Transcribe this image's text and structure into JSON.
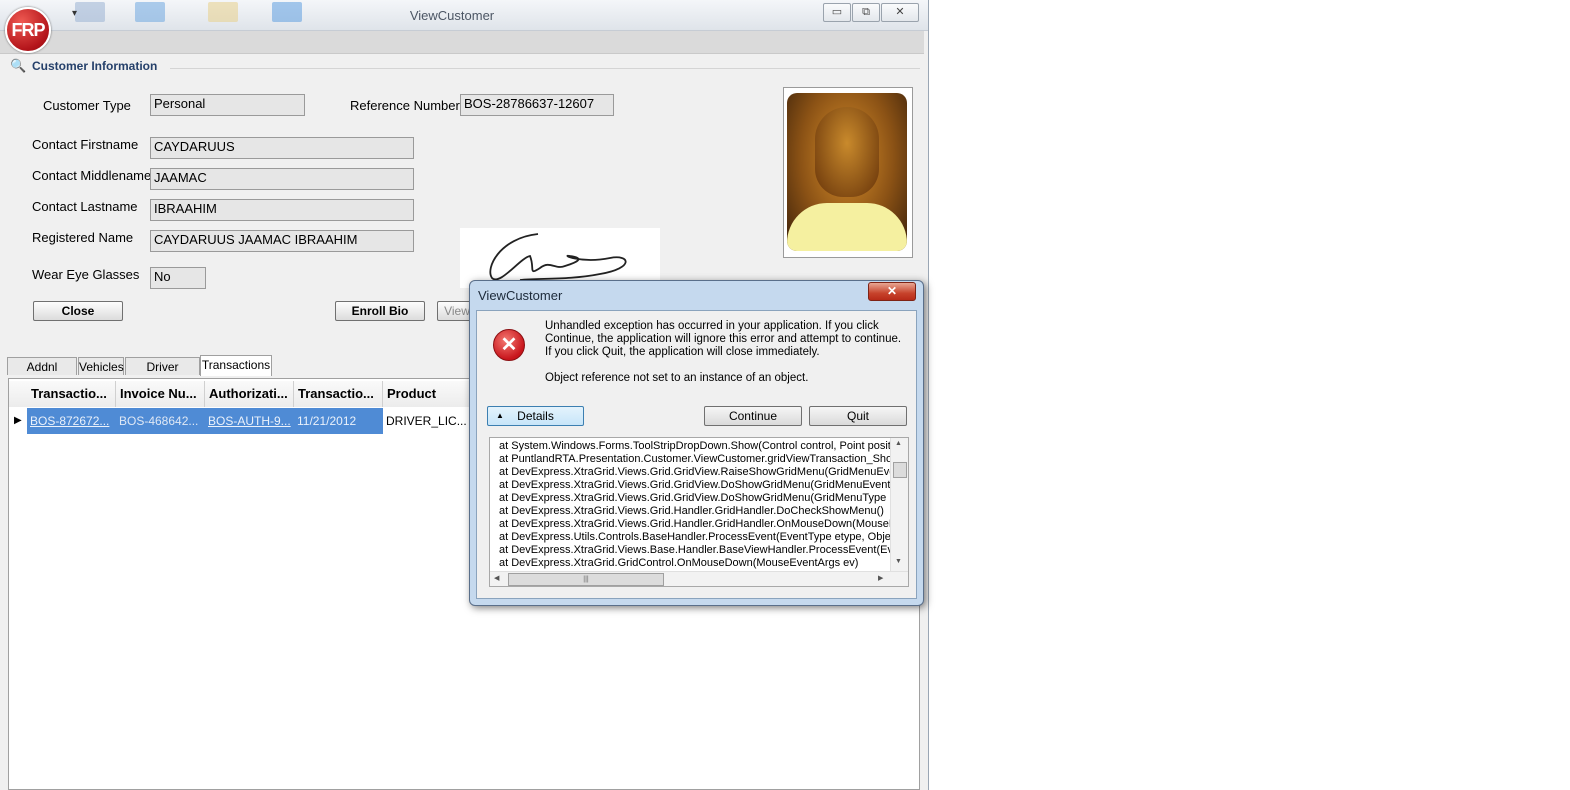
{
  "window": {
    "title": "ViewCustomer",
    "app_logo_text": "FRP",
    "min_glyph": "▭",
    "max_glyph": "⧉",
    "close_glyph": "✕",
    "qat_glyph": "▾"
  },
  "group": {
    "title": "Customer Information",
    "icon": "search-icon"
  },
  "form": {
    "customer_type_label": "Customer Type",
    "customer_type_value": "Personal",
    "reference_label": "Reference Number",
    "reference_value": "BOS-28786637-12607",
    "firstname_label": "Contact Firstname",
    "firstname_value": "CAYDARUUS",
    "middlename_label": "Contact Middlename",
    "middlename_value": "JAAMAC",
    "lastname_label": "Contact Lastname",
    "lastname_value": "IBRAAHIM",
    "registered_label": "Registered Name",
    "registered_value": "CAYDARUUS JAAMAC IBRAAHIM",
    "glasses_label": "Wear Eye Glasses",
    "glasses_value": "No"
  },
  "buttons": {
    "close": "Close",
    "enroll_bio": "Enroll Bio",
    "view": "View"
  },
  "tabs": [
    "Addnl Details",
    "Vehicles",
    "Driver License",
    "Transactions"
  ],
  "grid": {
    "columns": [
      "Transactio...",
      "Invoice Nu...",
      "Authorizati...",
      "Transactio...",
      "Product"
    ],
    "rows": [
      {
        "indicator": "▶",
        "cells": [
          "BOS-872672...",
          "BOS-468642...",
          "BOS-AUTH-9...",
          "11/21/2012",
          "DRIVER_LIC..."
        ]
      }
    ]
  },
  "dialog": {
    "title": "ViewCustomer",
    "close_glyph": "✕",
    "message": "Unhandled exception has occurred in your application. If you click Continue, the application will ignore this error and attempt to continue. If you click Quit, the application will close immediately.",
    "error_message": "Object reference not set to an instance of an object.",
    "details_label": "Details",
    "details_glyph": "▲",
    "continue_label": "Continue",
    "quit_label": "Quit",
    "stack_trace": [
      "at System.Windows.Forms.ToolStripDropDown.Show(Control control, Point position",
      "at PuntlandRTA.Presentation.Customer.ViewCustomer.gridViewTransaction_ShowG",
      "at DevExpress.XtraGrid.Views.Grid.GridView.RaiseShowGridMenu(GridMenuEventA",
      "at DevExpress.XtraGrid.Views.Grid.GridView.DoShowGridMenu(GridMenuEventArg",
      "at DevExpress.XtraGrid.Views.Grid.GridView.DoShowGridMenu(GridMenuType mer",
      "at DevExpress.XtraGrid.Views.Grid.Handler.GridHandler.DoCheckShowMenu()",
      "at DevExpress.XtraGrid.Views.Grid.Handler.GridHandler.OnMouseDown(MouseEve",
      "at DevExpress.Utils.Controls.BaseHandler.ProcessEvent(EventType etype, Object",
      "at DevExpress.XtraGrid.Views.Base.Handler.BaseViewHandler.ProcessEvent(Ever",
      "at DevExpress.XtraGrid.GridControl.OnMouseDown(MouseEventArgs ev)"
    ],
    "scroll_glyphs": {
      "up": "▲",
      "down": "▼",
      "left": "◀",
      "right": "▶",
      "grip": "|||"
    }
  },
  "colors": {
    "accent": "#4f8bd5",
    "error": "#c8151c",
    "dialog_frame": "#c5d9ee"
  }
}
